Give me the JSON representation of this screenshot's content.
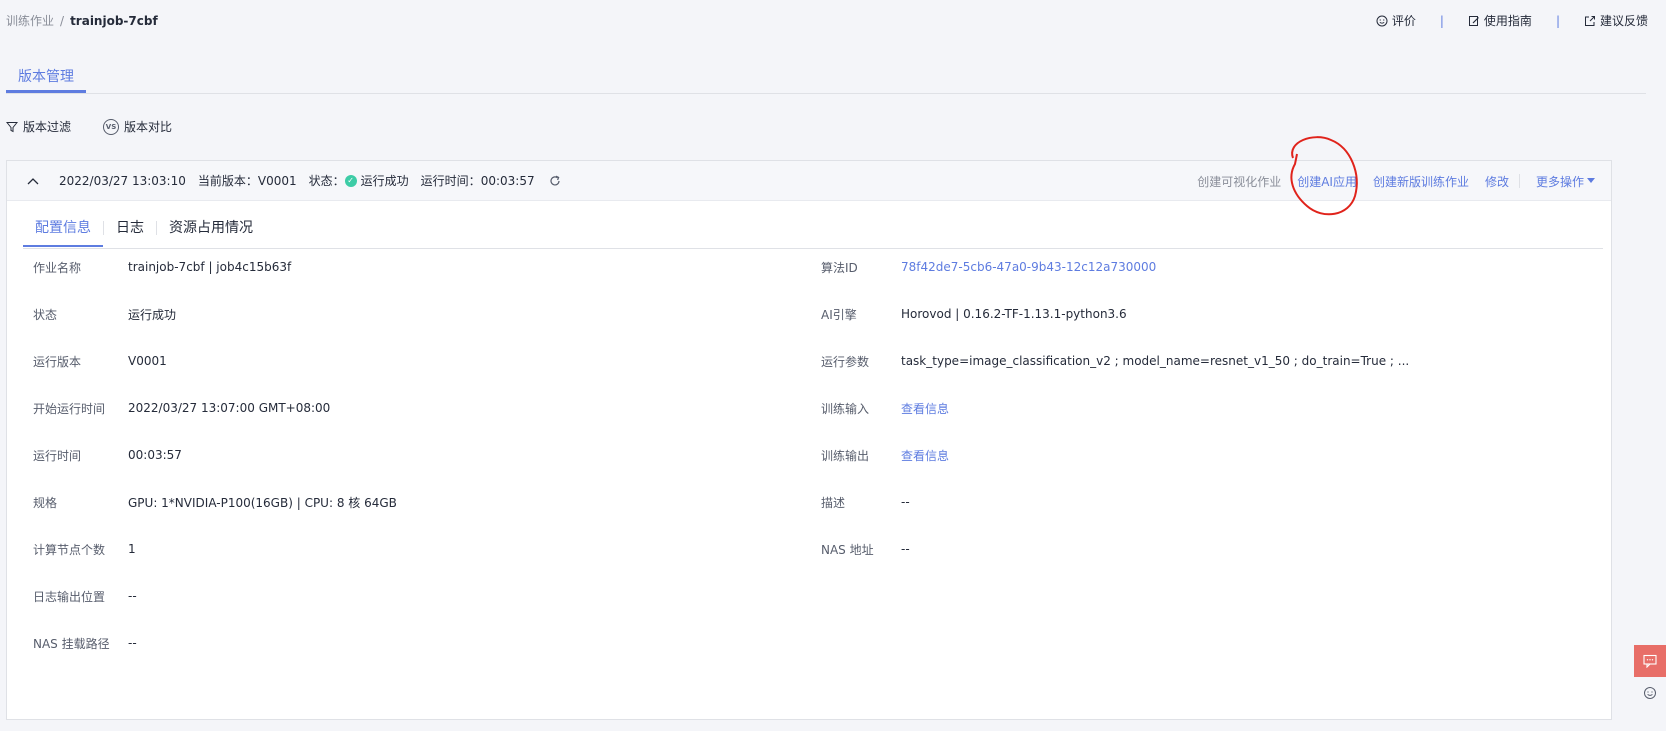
{
  "breadcrumb": {
    "parent": "训练作业",
    "separator": "/",
    "current": "trainjob-7cbf"
  },
  "top_actions": {
    "rate": "评价",
    "guide": "使用指南",
    "feedback": "建议反馈",
    "divider": "|"
  },
  "page_tabs": {
    "version_manage": "版本管理"
  },
  "tools": {
    "filter": "版本过滤",
    "compare": "版本对比",
    "vs_badge": "VS"
  },
  "version_header": {
    "datetime": "2022/03/27 13:03:10",
    "current_version_label": "当前版本：",
    "current_version": "V0001",
    "status_label": "状态：",
    "status": "运行成功",
    "runtime_label": "运行时间：",
    "runtime": "00:03:57"
  },
  "version_actions": {
    "create_vis": "创建可视化作业",
    "create_ai_app": "创建AI应用",
    "create_new_version": "创建新版训练作业",
    "modify": "修改",
    "more": "更多操作"
  },
  "inner_tabs": {
    "config": "配置信息",
    "log": "日志",
    "resource": "资源占用情况"
  },
  "left_info": [
    {
      "label": "作业名称",
      "value": "trainjob-7cbf | job4c15b63f"
    },
    {
      "label": "状态",
      "value": "运行成功"
    },
    {
      "label": "运行版本",
      "value": "V0001"
    },
    {
      "label": "开始运行时间",
      "value": "2022/03/27 13:07:00 GMT+08:00"
    },
    {
      "label": "运行时间",
      "value": "00:03:57"
    },
    {
      "label": "规格",
      "value": "GPU: 1*NVIDIA-P100(16GB) | CPU: 8 核 64GB"
    },
    {
      "label": "计算节点个数",
      "value": "1"
    },
    {
      "label": "日志输出位置",
      "value": "--"
    },
    {
      "label": "NAS 挂载路径",
      "value": "--"
    }
  ],
  "right_info": [
    {
      "label": "算法ID",
      "value": "78f42de7-5cb6-47a0-9b43-12c12a730000"
    },
    {
      "label": "AI引擎",
      "value": "Horovod | 0.16.2-TF-1.13.1-python3.6"
    },
    {
      "label": "运行参数",
      "value": "task_type=image_classification_v2 ; model_name=resnet_v1_50 ; do_train=True ; ..."
    },
    {
      "label": "训练输入",
      "value": "查看信息"
    },
    {
      "label": "训练输出",
      "value": "查看信息"
    },
    {
      "label": "描述",
      "value": "--"
    },
    {
      "label": "NAS 地址",
      "value": "--"
    }
  ],
  "colors": {
    "accent": "#5e7ce0",
    "success": "#3dcca6",
    "annotation": "#e0231b",
    "float_btn": "#e86e68"
  },
  "icons": [
    "filter-icon",
    "vs-icon",
    "collapse-icon",
    "success-check-icon",
    "refresh-icon",
    "smile-icon",
    "edit-icon",
    "external-icon",
    "chevron-down-icon",
    "chat-icon"
  ]
}
